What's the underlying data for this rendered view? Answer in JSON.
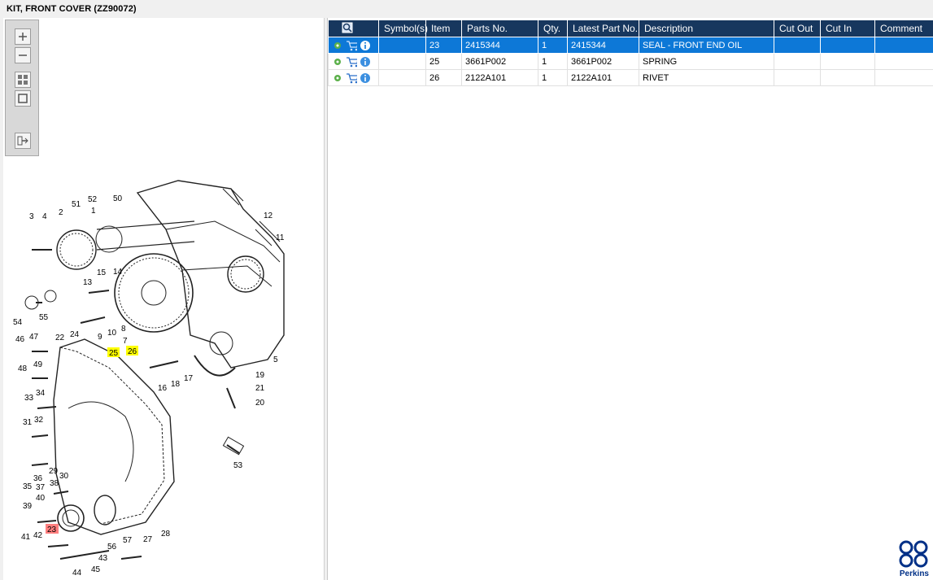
{
  "window": {
    "title": "KIT, FRONT COVER (ZZ90072)"
  },
  "toolbar": {
    "icons": [
      "zoom-in-icon",
      "zoom-out-icon",
      "fit-page-icon",
      "actual-size-icon",
      "export-icon"
    ]
  },
  "diagram": {
    "callouts": [
      "1",
      "2",
      "3",
      "4",
      "5",
      "7",
      "8",
      "9",
      "10",
      "11",
      "12",
      "13",
      "14",
      "15",
      "16",
      "17",
      "18",
      "19",
      "20",
      "21",
      "22",
      "24",
      "25",
      "26",
      "27",
      "28",
      "29",
      "30",
      "31",
      "32",
      "33",
      "34",
      "35",
      "36",
      "37",
      "38",
      "39",
      "40",
      "41",
      "42",
      "43",
      "44",
      "45",
      "46",
      "47",
      "48",
      "49",
      "50",
      "51",
      "52",
      "53",
      "54",
      "55",
      "56",
      "57",
      "23"
    ],
    "highlight_yellow": [
      "25",
      "26"
    ],
    "highlight_red": [
      "23"
    ]
  },
  "table": {
    "columns": [
      "Symbol(s)",
      "Item",
      "Parts No.",
      "Qty.",
      "Latest Part No.",
      "Description",
      "Cut Out",
      "Cut In",
      "Comment"
    ],
    "rows": [
      {
        "symbols": "",
        "item": "23",
        "parts_no": "2415344",
        "qty": "1",
        "latest": "2415344",
        "description": "SEAL - FRONT END OIL",
        "cut_out": "",
        "cut_in": "",
        "comment": ""
      },
      {
        "symbols": "",
        "item": "25",
        "parts_no": "3661P002",
        "qty": "1",
        "latest": "3661P002",
        "description": "SPRING",
        "cut_out": "",
        "cut_in": "",
        "comment": ""
      },
      {
        "symbols": "",
        "item": "26",
        "parts_no": "2122A101",
        "qty": "1",
        "latest": "2122A101",
        "description": "RIVET",
        "cut_out": "",
        "cut_in": "",
        "comment": ""
      }
    ]
  },
  "brand": {
    "name": "Perkins",
    "color": "#003087"
  },
  "colors": {
    "header": "#17375e",
    "selected": "#0d78d7",
    "yellow": "#ffff00",
    "red": "#ff7f7f"
  }
}
